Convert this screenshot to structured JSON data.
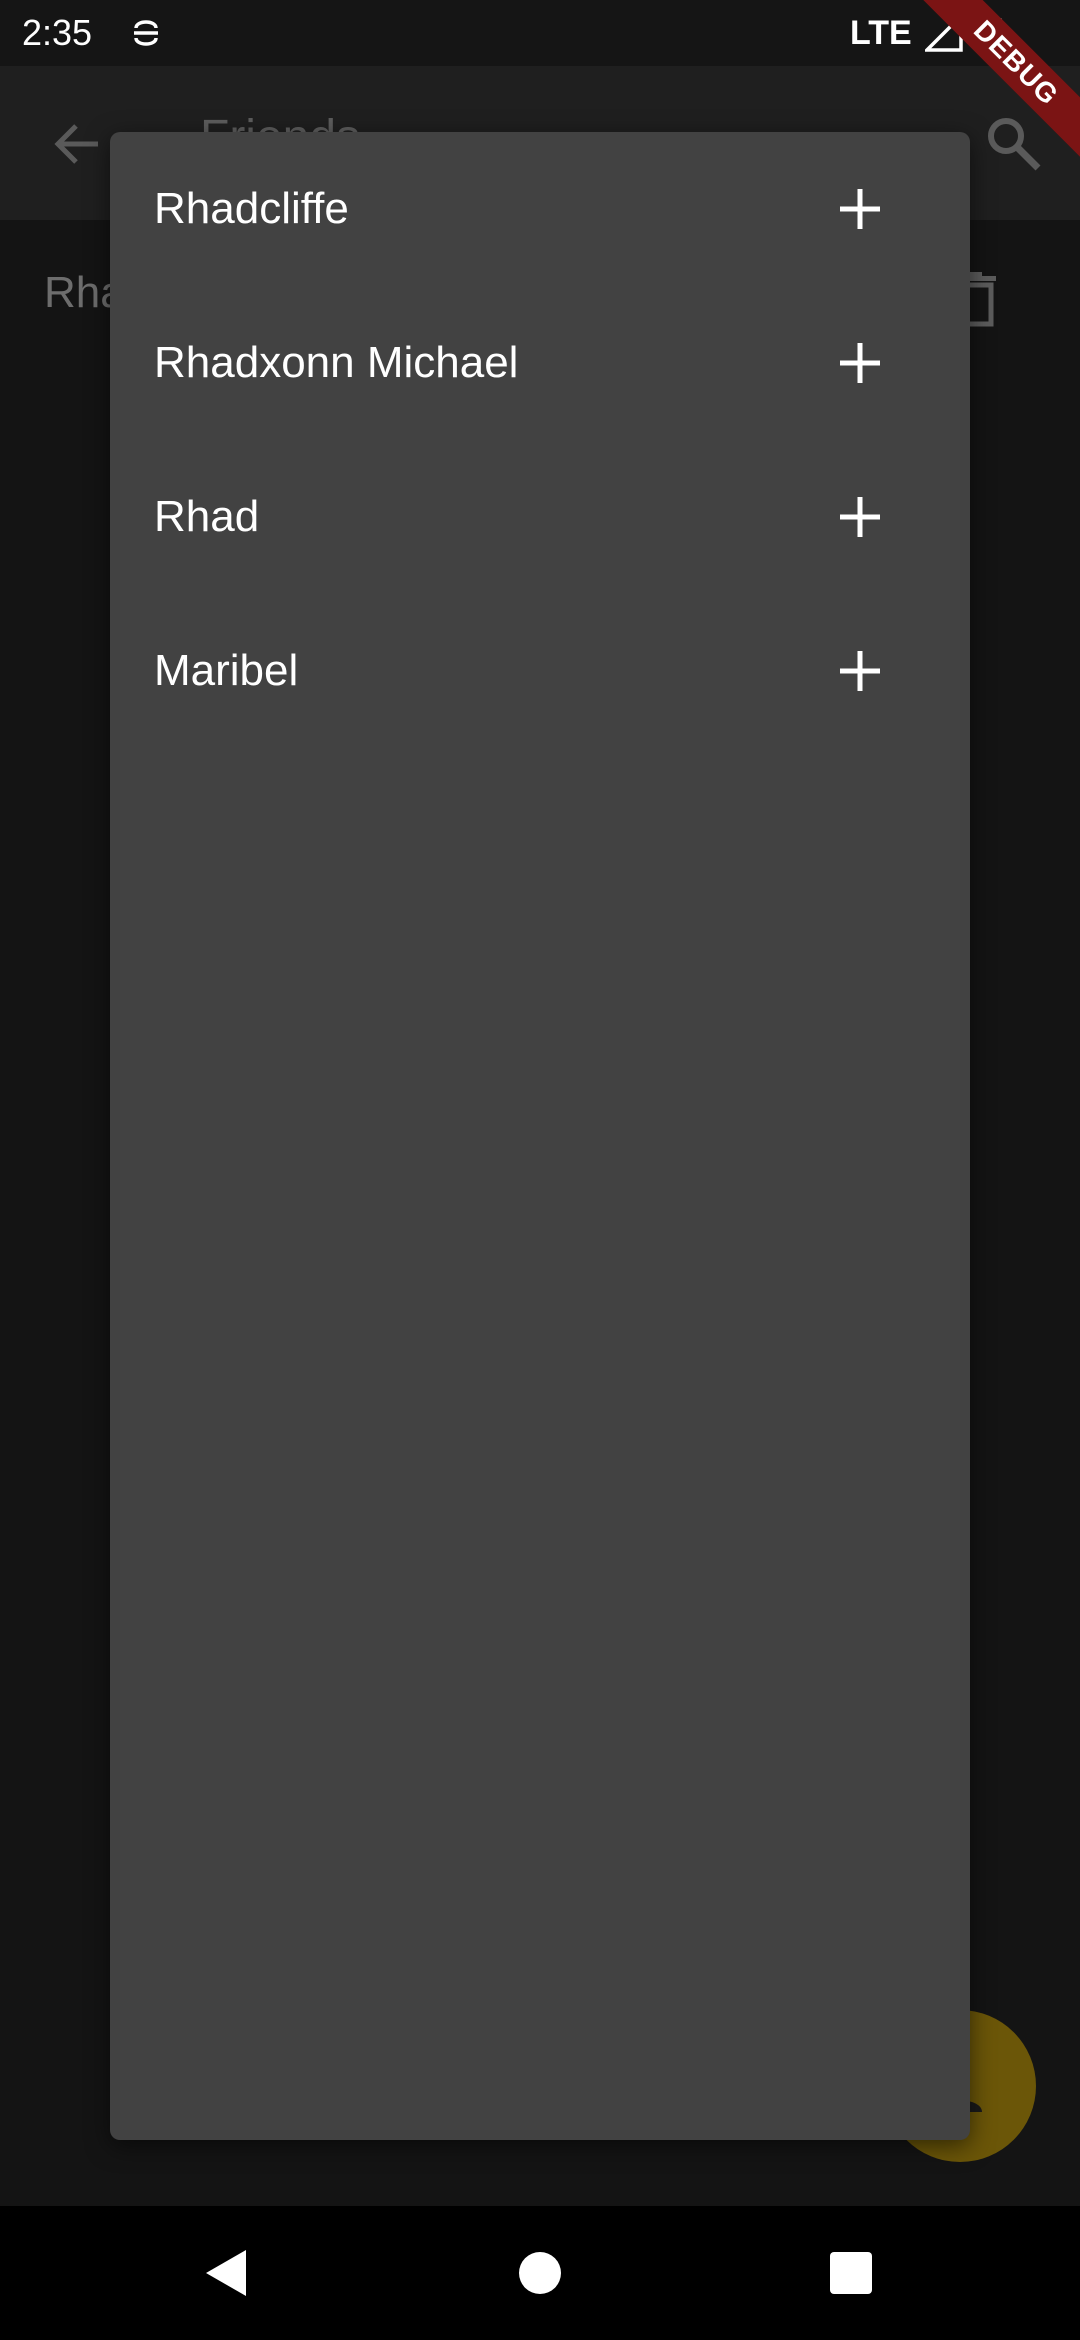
{
  "status_bar": {
    "time": "2:35",
    "network": "LTE"
  },
  "debug_banner": {
    "label": "DEBUG"
  },
  "app_bar": {
    "title": "Friends",
    "back_icon": "arrow-back-icon",
    "search_icon": "search-icon"
  },
  "background_list": {
    "first_item_label": "Rha",
    "delete_icon": "trash-icon"
  },
  "dropdown": {
    "items": [
      {
        "label": "Rhadcliffe",
        "action_icon": "plus-icon"
      },
      {
        "label": "Rhadxonn Michael",
        "action_icon": "plus-icon"
      },
      {
        "label": "Rhad",
        "action_icon": "plus-icon"
      },
      {
        "label": "Maribel",
        "action_icon": "plus-icon"
      }
    ]
  },
  "fab": {
    "icon": "person-add-icon"
  },
  "colors": {
    "background": "#141414",
    "app_bar": "#1f1f1f",
    "dropdown": "#424242",
    "fab": "#6b5608",
    "debug_ribbon": "#7b1414"
  }
}
